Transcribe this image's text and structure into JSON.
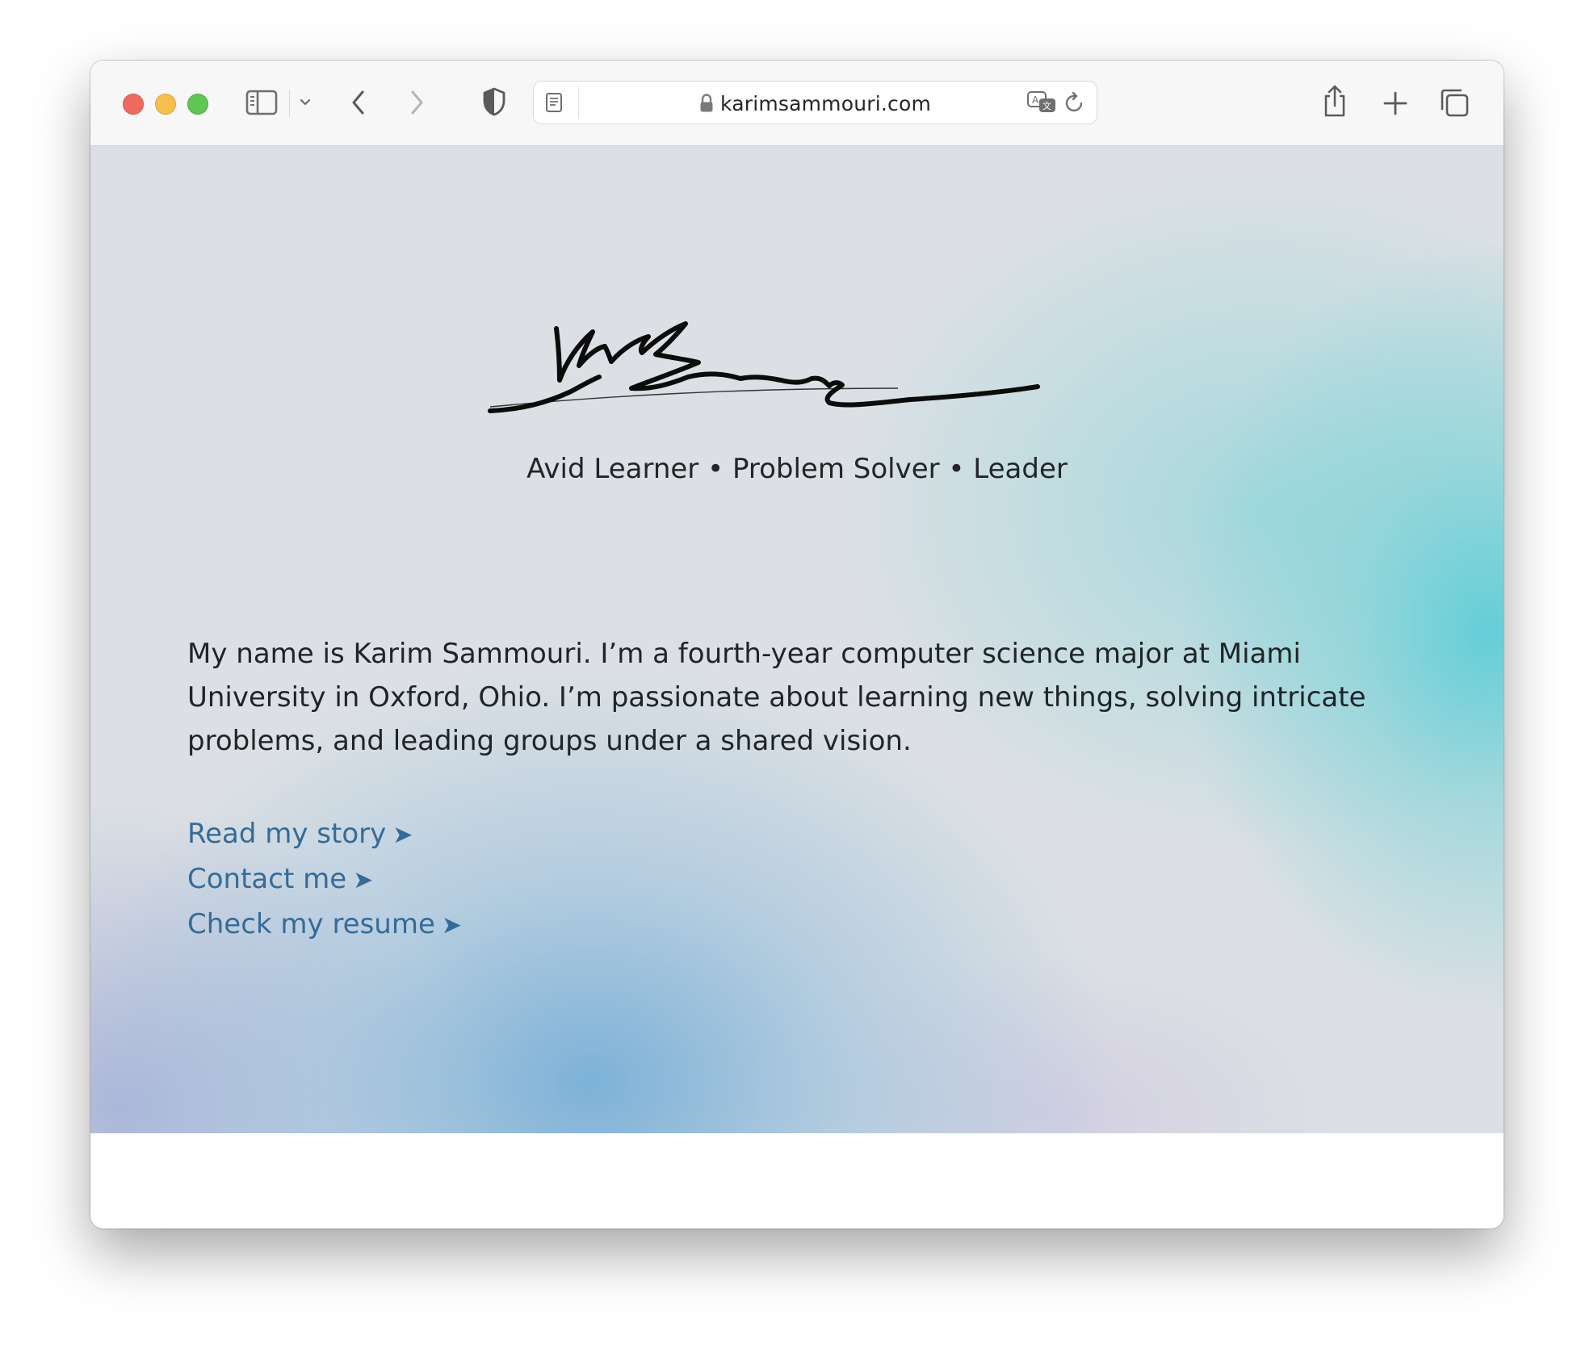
{
  "browser": {
    "url": "karimsammouri.com",
    "traffic_lights": {
      "close": "#ed6a5e",
      "minimize": "#f5bf4f",
      "maximize": "#61c554"
    }
  },
  "page": {
    "tagline": "Avid Learner • Problem Solver • Leader",
    "bio": "My name is Karim Sammouri. I’m a fourth-year computer science major at Miami University in Oxford, Ohio. I’m passionate about learning new things, solving intricate problems, and leading groups under a shared vision.",
    "links": [
      {
        "label": "Read my story",
        "arrow": "➤"
      },
      {
        "label": "Contact me",
        "arrow": "➤"
      },
      {
        "label": "Check my resume",
        "arrow": "➤"
      }
    ],
    "link_color": "#356b97"
  }
}
